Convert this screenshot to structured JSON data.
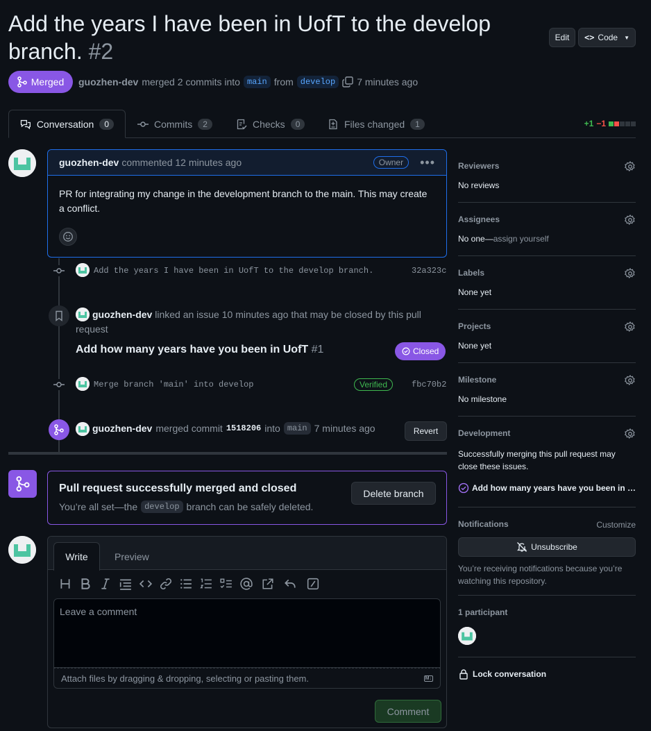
{
  "header": {
    "title": "Add the years I have been in UofT to the develop branch.",
    "number": "#2",
    "edit_label": "Edit",
    "code_label": "Code"
  },
  "status": {
    "state_label": "Merged",
    "author": "guozhen-dev",
    "merge_text": "merged 2 commits into",
    "base_branch": "main",
    "from_text": "from",
    "head_branch": "develop",
    "time": "7 minutes ago"
  },
  "tabs": [
    {
      "label": "Conversation",
      "count": "0"
    },
    {
      "label": "Commits",
      "count": "2"
    },
    {
      "label": "Checks",
      "count": "0"
    },
    {
      "label": "Files changed",
      "count": "1"
    }
  ],
  "diffstat": {
    "additions": "+1",
    "deletions": "−1"
  },
  "comment": {
    "author": "guozhen-dev",
    "action": "commented 12 minutes ago",
    "role": "Owner",
    "body": "PR for integrating my change in the development branch to the main. This may create a conflict."
  },
  "timeline": {
    "commit1": {
      "message": "Add the years I have been in UofT to the develop branch.",
      "sha": "32a323c"
    },
    "linked": {
      "author": "guozhen-dev",
      "text": "linked an issue 10 minutes ago that may be closed by this pull request",
      "issue_title": "Add how many years have you been in UofT",
      "issue_number": "#1",
      "issue_state": "Closed"
    },
    "commit2": {
      "message": "Merge branch 'main' into develop",
      "badge": "Verified",
      "sha": "fbc70b2"
    },
    "merge": {
      "author": "guozhen-dev",
      "text": "merged commit",
      "sha": "1518206",
      "into": "into",
      "branch": "main",
      "time": "7 minutes ago",
      "revert_label": "Revert"
    }
  },
  "merged_box": {
    "title": "Pull request successfully merged and closed",
    "desc_pre": "You’re all set—the",
    "branch": "develop",
    "desc_post": "branch can be safely deleted.",
    "delete_label": "Delete branch"
  },
  "editor": {
    "write_tab": "Write",
    "preview_tab": "Preview",
    "placeholder": "Leave a comment",
    "attach_hint": "Attach files by dragging & dropping, selecting or pasting them.",
    "submit_label": "Comment"
  },
  "sidebar": {
    "reviewers": {
      "title": "Reviewers",
      "value": "No reviews"
    },
    "assignees": {
      "title": "Assignees",
      "value": "No one—",
      "link": "assign yourself"
    },
    "labels": {
      "title": "Labels",
      "value": "None yet"
    },
    "projects": {
      "title": "Projects",
      "value": "None yet"
    },
    "milestone": {
      "title": "Milestone",
      "value": "No milestone"
    },
    "development": {
      "title": "Development",
      "value": "Successfully merging this pull request may close these issues.",
      "issue": "Add how many years have you been in …"
    },
    "notifications": {
      "title": "Notifications",
      "customize": "Customize",
      "unsubscribe": "Unsubscribe",
      "note": "You’re receiving notifications because you’re watching this repository."
    },
    "participants": {
      "title": "1 participant"
    },
    "lock": "Lock conversation"
  },
  "colors": {
    "accent_merged": "#8957e5",
    "link": "#58a6ff",
    "success": "#238636"
  }
}
